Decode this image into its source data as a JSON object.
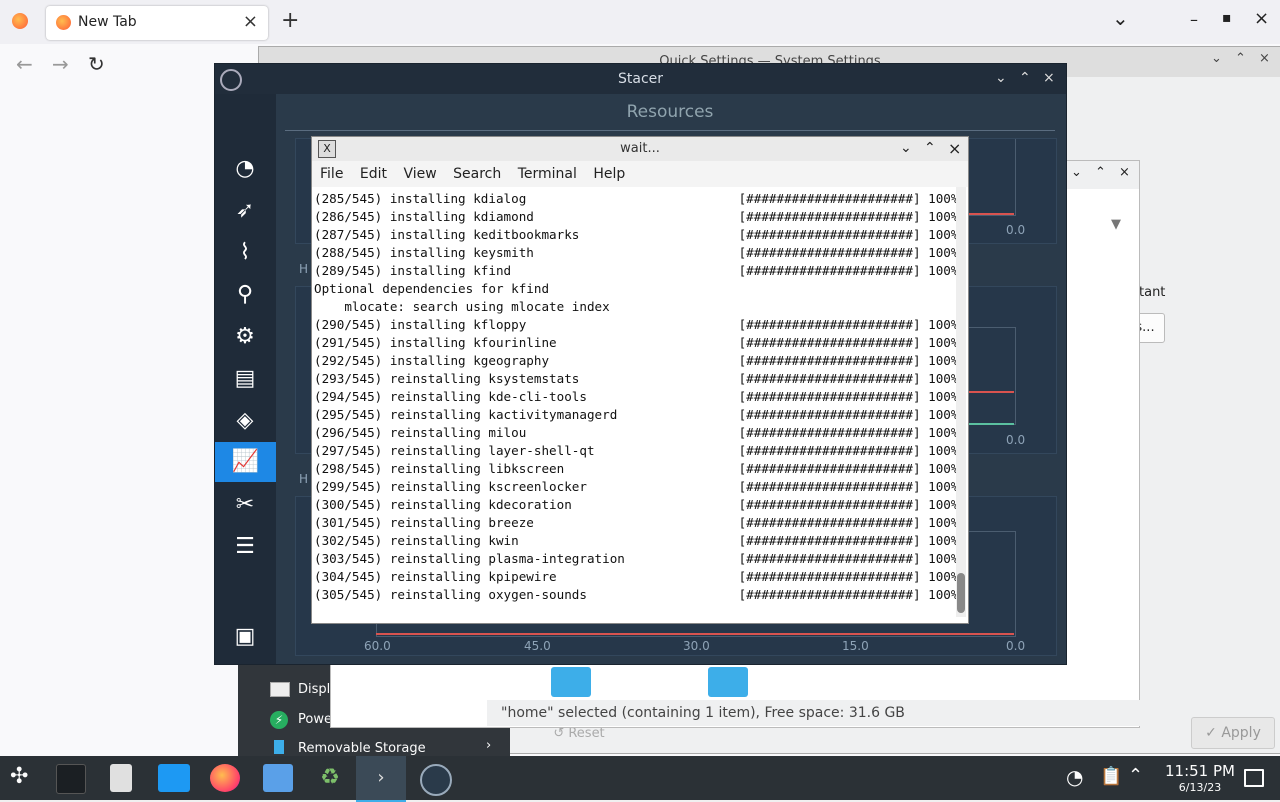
{
  "firefox": {
    "tab_title": "New Tab",
    "new_tab": "+",
    "close_tab": "×",
    "nav_back": "←",
    "nav_forward": "→",
    "nav_reload": "↻",
    "win_list": "⌄",
    "win_min": "–",
    "win_max": "▪",
    "win_close": "×"
  },
  "system_settings": {
    "title": "Quick Settings — System Settings",
    "sidebar": [
      "Display",
      "Power",
      "Removable Storage"
    ],
    "right_text": "tant",
    "right_button": "s...",
    "apply": "Apply",
    "reset": "Reset"
  },
  "dolphin": {
    "status": "\"home\" selected (containing 1 item), Free space: 31.6 GB"
  },
  "stacer": {
    "title": "Stacer",
    "section": "Resources",
    "panel_label_h": "H",
    "axis_values": [
      "60.0",
      "45.0",
      "30.0",
      "15.0",
      "0.0"
    ],
    "top_right_value": "0.0",
    "mid_right_value": "0.0",
    "sidebar_icons": [
      "dashboard-icon",
      "rocket-icon",
      "broom-icon",
      "search-icon",
      "gears-icon",
      "layers-icon",
      "package-icon",
      "chart-icon",
      "tools-icon",
      "sliders-icon",
      "feedback-icon"
    ]
  },
  "terminal": {
    "title": "wait...",
    "menu": [
      "File",
      "Edit",
      "View",
      "Search",
      "Terminal",
      "Help"
    ],
    "lines": [
      "(285/545) installing kdialog                            [######################] 100%",
      "(286/545) installing kdiamond                           [######################] 100%",
      "(287/545) installing keditbookmarks                     [######################] 100%",
      "(288/545) installing keysmith                           [######################] 100%",
      "(289/545) installing kfind                              [######################] 100%",
      "Optional dependencies for kfind",
      "    mlocate: search using mlocate index",
      "(290/545) installing kfloppy                            [######################] 100%",
      "(291/545) installing kfourinline                        [######################] 100%",
      "(292/545) installing kgeography                         [######################] 100%",
      "(293/545) reinstalling ksystemstats                     [######################] 100%",
      "(294/545) reinstalling kde-cli-tools                    [######################] 100%",
      "(295/545) reinstalling kactivitymanagerd                [######################] 100%",
      "(296/545) reinstalling milou                            [######################] 100%",
      "(297/545) reinstalling layer-shell-qt                   [######################] 100%",
      "(298/545) reinstalling libkscreen                       [######################] 100%",
      "(299/545) reinstalling kscreenlocker                    [######################] 100%",
      "(300/545) reinstalling kdecoration                      [######################] 100%",
      "(301/545) reinstalling breeze                           [######################] 100%",
      "(302/545) reinstalling kwin                             [######################] 100%",
      "(303/545) reinstalling plasma-integration               [######################] 100%",
      "(304/545) reinstalling kpipewire                        [######################] 100%",
      "(305/545) reinstalling oxygen-sounds                    [######################] 100%"
    ]
  },
  "taskbar": {
    "time": "11:51 PM",
    "date": "6/13/23"
  }
}
